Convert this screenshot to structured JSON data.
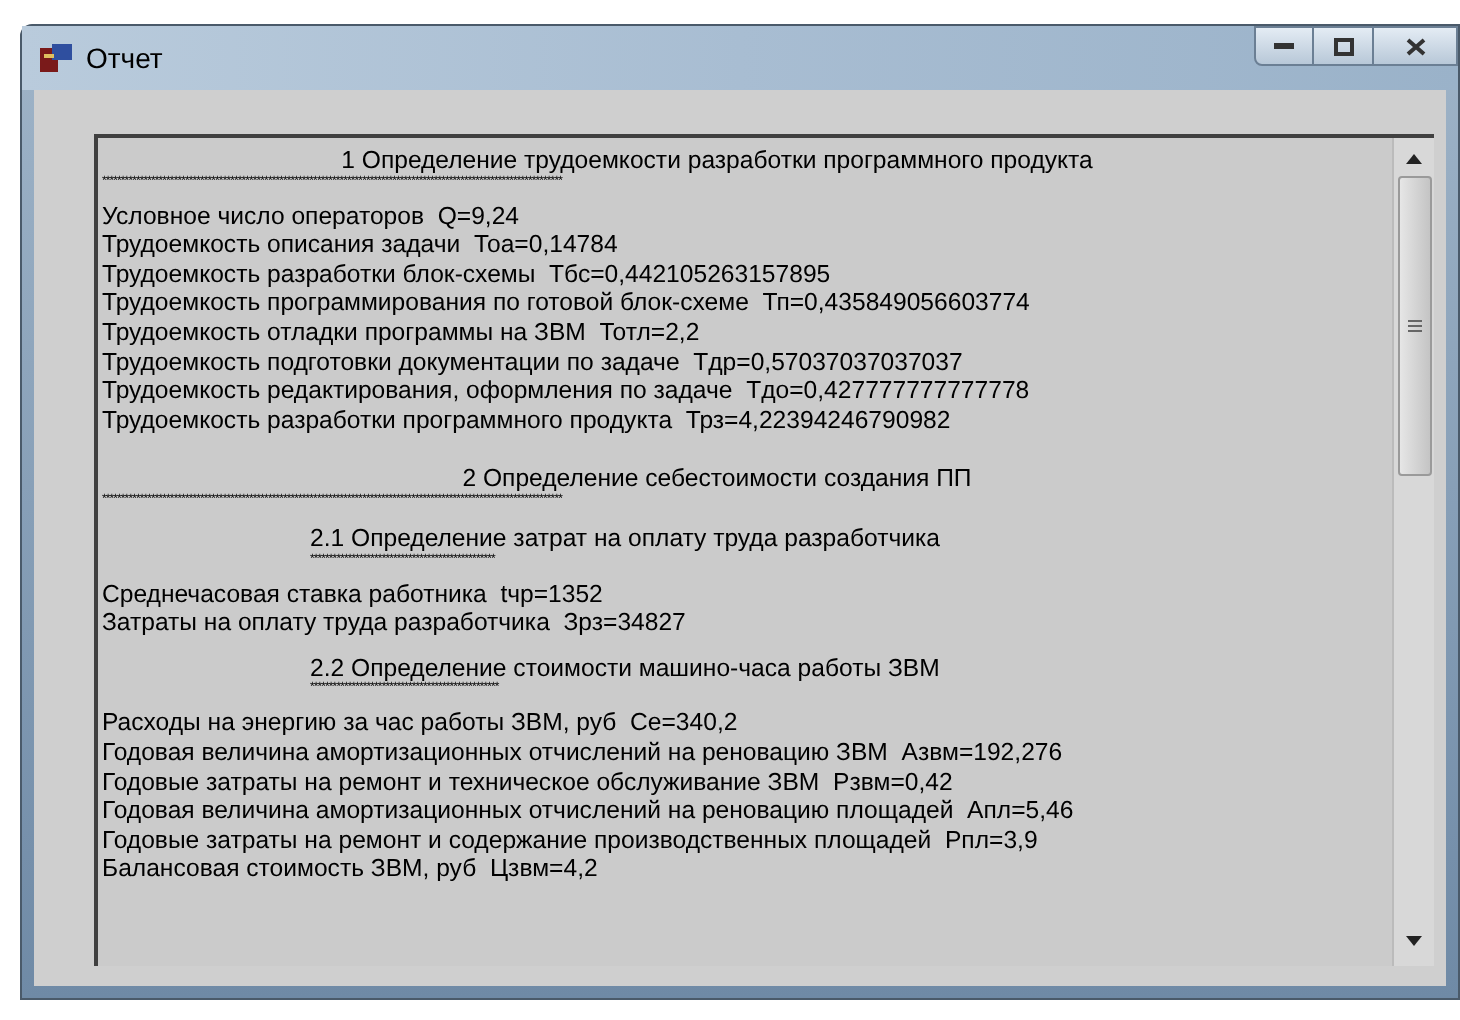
{
  "window": {
    "title": "Отчет"
  },
  "report": {
    "lines": [
      {
        "kind": "heading",
        "text": "1 Определение трудоемкости разработки программного продукта"
      },
      {
        "kind": "stars",
        "text": "**************************************************************************************************************************"
      },
      {
        "kind": "text",
        "text": "Условное число операторов  Q=9,24"
      },
      {
        "kind": "text",
        "text": "Трудоемкость описания задачи  Тоа=0,14784"
      },
      {
        "kind": "text",
        "text": "Трудоемкость разработки блок-схемы  Тбс=0,442105263157895"
      },
      {
        "kind": "text",
        "text": "Трудоемкость программирования по готовой блок-схеме  Тп=0,435849056603774"
      },
      {
        "kind": "text",
        "text": "Трудоемкость отладки программы на ЗВМ  Тотл=2,2"
      },
      {
        "kind": "text",
        "text": "Трудоемкость подготовки документации по задаче  Тдр=0,57037037037037"
      },
      {
        "kind": "text",
        "text": "Трудоемкость редактирования, оформления по задаче  Тдо=0,427777777777778"
      },
      {
        "kind": "text",
        "text": "Трудоемкость разработки программного продукта  Трз=4,22394246790982"
      },
      {
        "kind": "heading",
        "text": "2 Определение себестоимости создания ПП"
      },
      {
        "kind": "stars",
        "text": "**************************************************************************************************************************"
      },
      {
        "kind": "subheading",
        "text": "2.1 Определение затрат на оплату труда разработчика"
      },
      {
        "kind": "substars",
        "text": "*************************************************"
      },
      {
        "kind": "text",
        "text": "Среднечасовая ставка работника  tчр=1352"
      },
      {
        "kind": "text",
        "text": "Затраты на оплату труда разработчика  Зрз=34827"
      },
      {
        "kind": "subheading",
        "text": "2.2 Определение стоимости машино-часа работы ЗВМ"
      },
      {
        "kind": "substars",
        "text": "**************************************************"
      },
      {
        "kind": "text",
        "text": "Расходы на энергию за час работы ЗВМ, руб  Се=340,2"
      },
      {
        "kind": "text",
        "text": "Годовая величина амортизационных отчислений на реновацию ЗВМ  Азвм=192,276"
      },
      {
        "kind": "text",
        "text": "Годовые затраты на ремонт и техническое обслуживание ЗВМ  Рзвм=0,42"
      },
      {
        "kind": "text",
        "text": "Годовая величина амортизационных отчислений на реновацию площадей  Апл=5,46"
      },
      {
        "kind": "text",
        "text": "Годовые затраты на ремонт и содержание производственных площадей  Рпл=3,9"
      },
      {
        "kind": "text",
        "text": "Балансовая стоимость ЗВМ, руб  Цзвм=4,2"
      }
    ]
  }
}
